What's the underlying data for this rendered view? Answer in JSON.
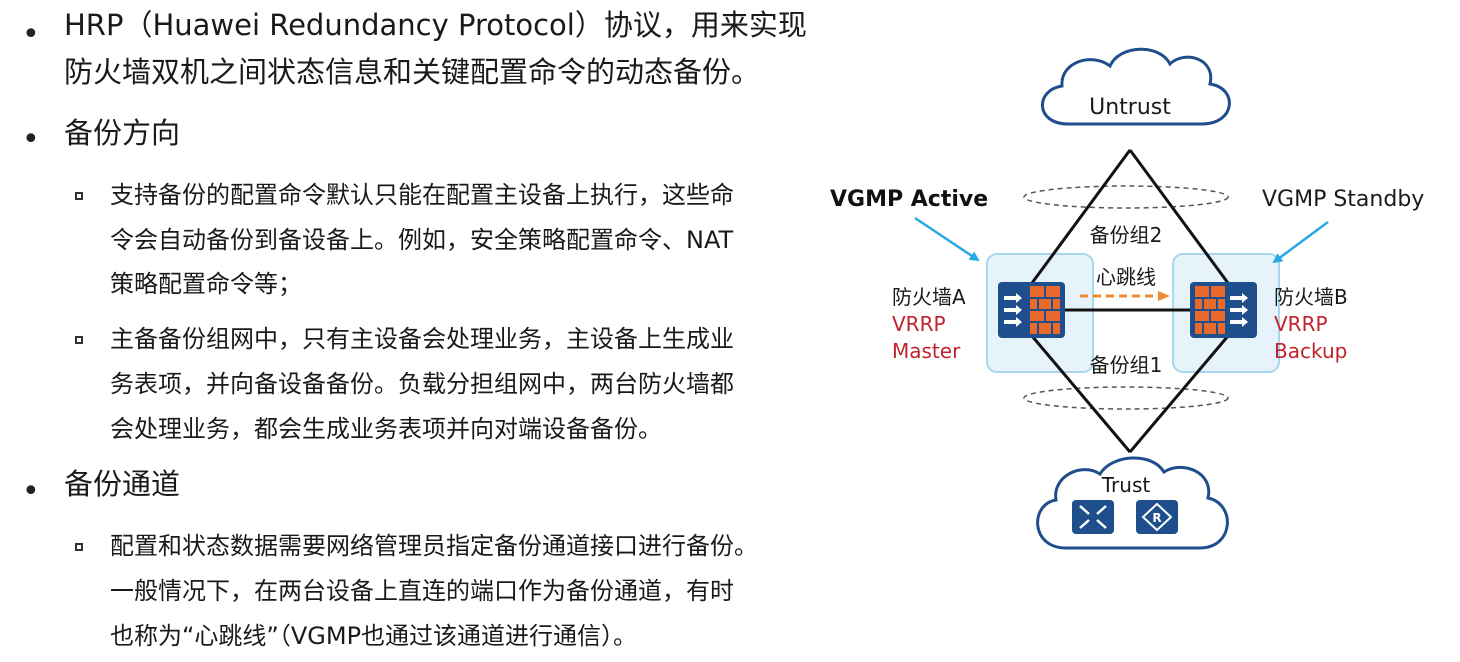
{
  "text": {
    "b1_lines": [
      "HRP（Huawei Redundancy Protocol）协议，用来实现",
      "防火墙双机之间状态信息和关键配置命令的动态备份。"
    ],
    "b2_title": "备份方向",
    "b2_items": [
      [
        "支持备份的配置命令默认只能在配置主设备上执行，这些命",
        "令会自动备份到备设备上。例如，安全策略配置命令、NAT",
        "策略配置命令等；"
      ],
      [
        "主备备份组网中，只有主设备会处理业务，主设备上生成业",
        "务表项，并向备设备备份。负载分担组网中，两台防火墙都",
        "会处理业务，都会生成业务表项并向对端设备备份。"
      ]
    ],
    "b3_title": "备份通道",
    "b3_items": [
      [
        "配置和状态数据需要网络管理员指定备份通道接口进行备份。",
        "一般情况下，在两台设备上直连的端口作为备份通道，有时",
        "也称为“心跳线”（VGMP也通过该通道进行通信）。"
      ]
    ]
  },
  "diagram": {
    "untrust": "Untrust",
    "trust": "Trust",
    "vgmp_active": "VGMP Active",
    "vgmp_standby": "VGMP Standby",
    "group2": "备份组2",
    "group1": "备份组1",
    "heartbeat": "心跳线",
    "fw_a": "防火墙A",
    "fw_b": "防火墙B",
    "vrrp_a": [
      "VRRP",
      "Master"
    ],
    "vrrp_b": [
      "VRRP",
      "Backup"
    ],
    "colors": {
      "device_blue": "#1f4e8c",
      "brick": "#e8692b",
      "box_fill": "#e6f3fb",
      "box_stroke": "#a9d6ee",
      "arrow_cyan": "#27a9e1",
      "vrrp_red": "#c0232c",
      "heartbeat_orange": "#f08a2c"
    }
  }
}
